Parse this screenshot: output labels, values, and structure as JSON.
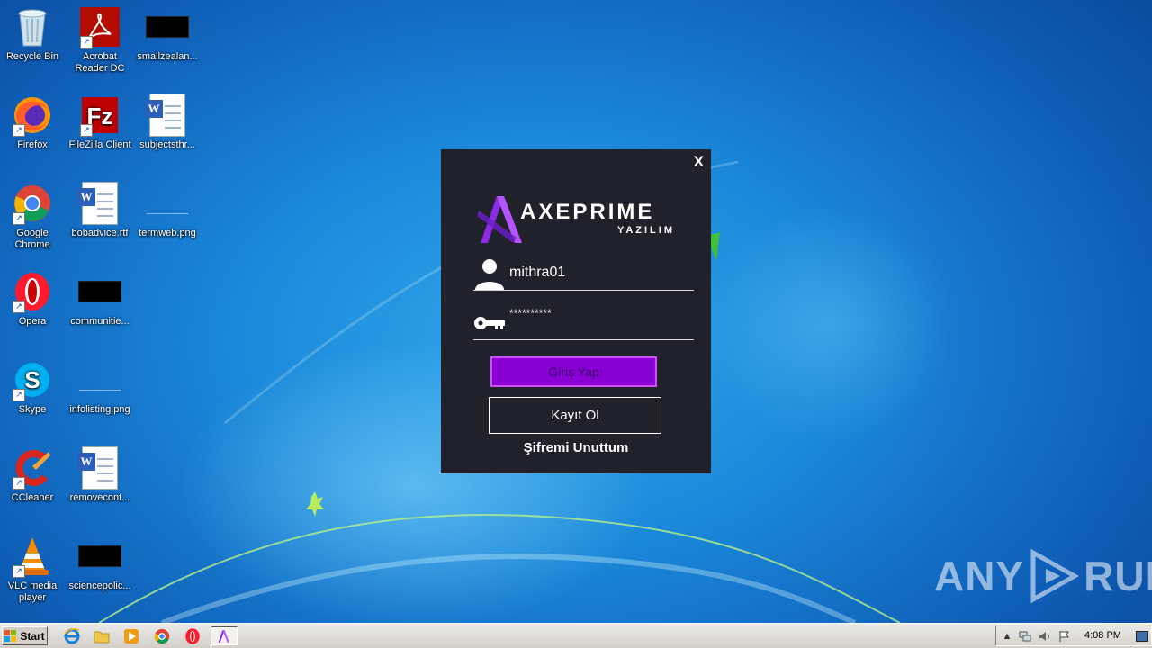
{
  "desktop": {
    "icons": [
      {
        "label": "Recycle Bin"
      },
      {
        "label": "Acrobat Reader DC"
      },
      {
        "label": "smallzealan..."
      },
      {
        "label": "Firefox"
      },
      {
        "label": "FileZilla Client"
      },
      {
        "label": "subjectsthr..."
      },
      {
        "label": "Google Chrome"
      },
      {
        "label": "bobadvice.rtf"
      },
      {
        "label": "termweb.png"
      },
      {
        "label": "Opera"
      },
      {
        "label": "communitie..."
      },
      {
        "label": "Skype"
      },
      {
        "label": "infolisting.png"
      },
      {
        "label": "CCleaner"
      },
      {
        "label": "removecont..."
      },
      {
        "label": "VLC media player"
      },
      {
        "label": "sciencepolic..."
      }
    ]
  },
  "dialog": {
    "close_label": "X",
    "brand_title": "AXEPRIME",
    "brand_subtitle": "YAZILIM",
    "username_value": "mithra01",
    "password_value": "**********",
    "login_label": "Giriş Yap",
    "register_label": "Kayıt Ol",
    "forgot_label": "Şifremi Unuttum",
    "accent_color": "#8a00d4",
    "background_color": "#20212b"
  },
  "watermark": {
    "text_left": "ANY",
    "text_right": "RUN"
  },
  "taskbar": {
    "start_label": "Start",
    "quick_launch": [
      "ie-icon",
      "folder-icon",
      "media-player-icon",
      "chrome-icon",
      "opera-icon"
    ],
    "clock": "4:08 PM"
  }
}
